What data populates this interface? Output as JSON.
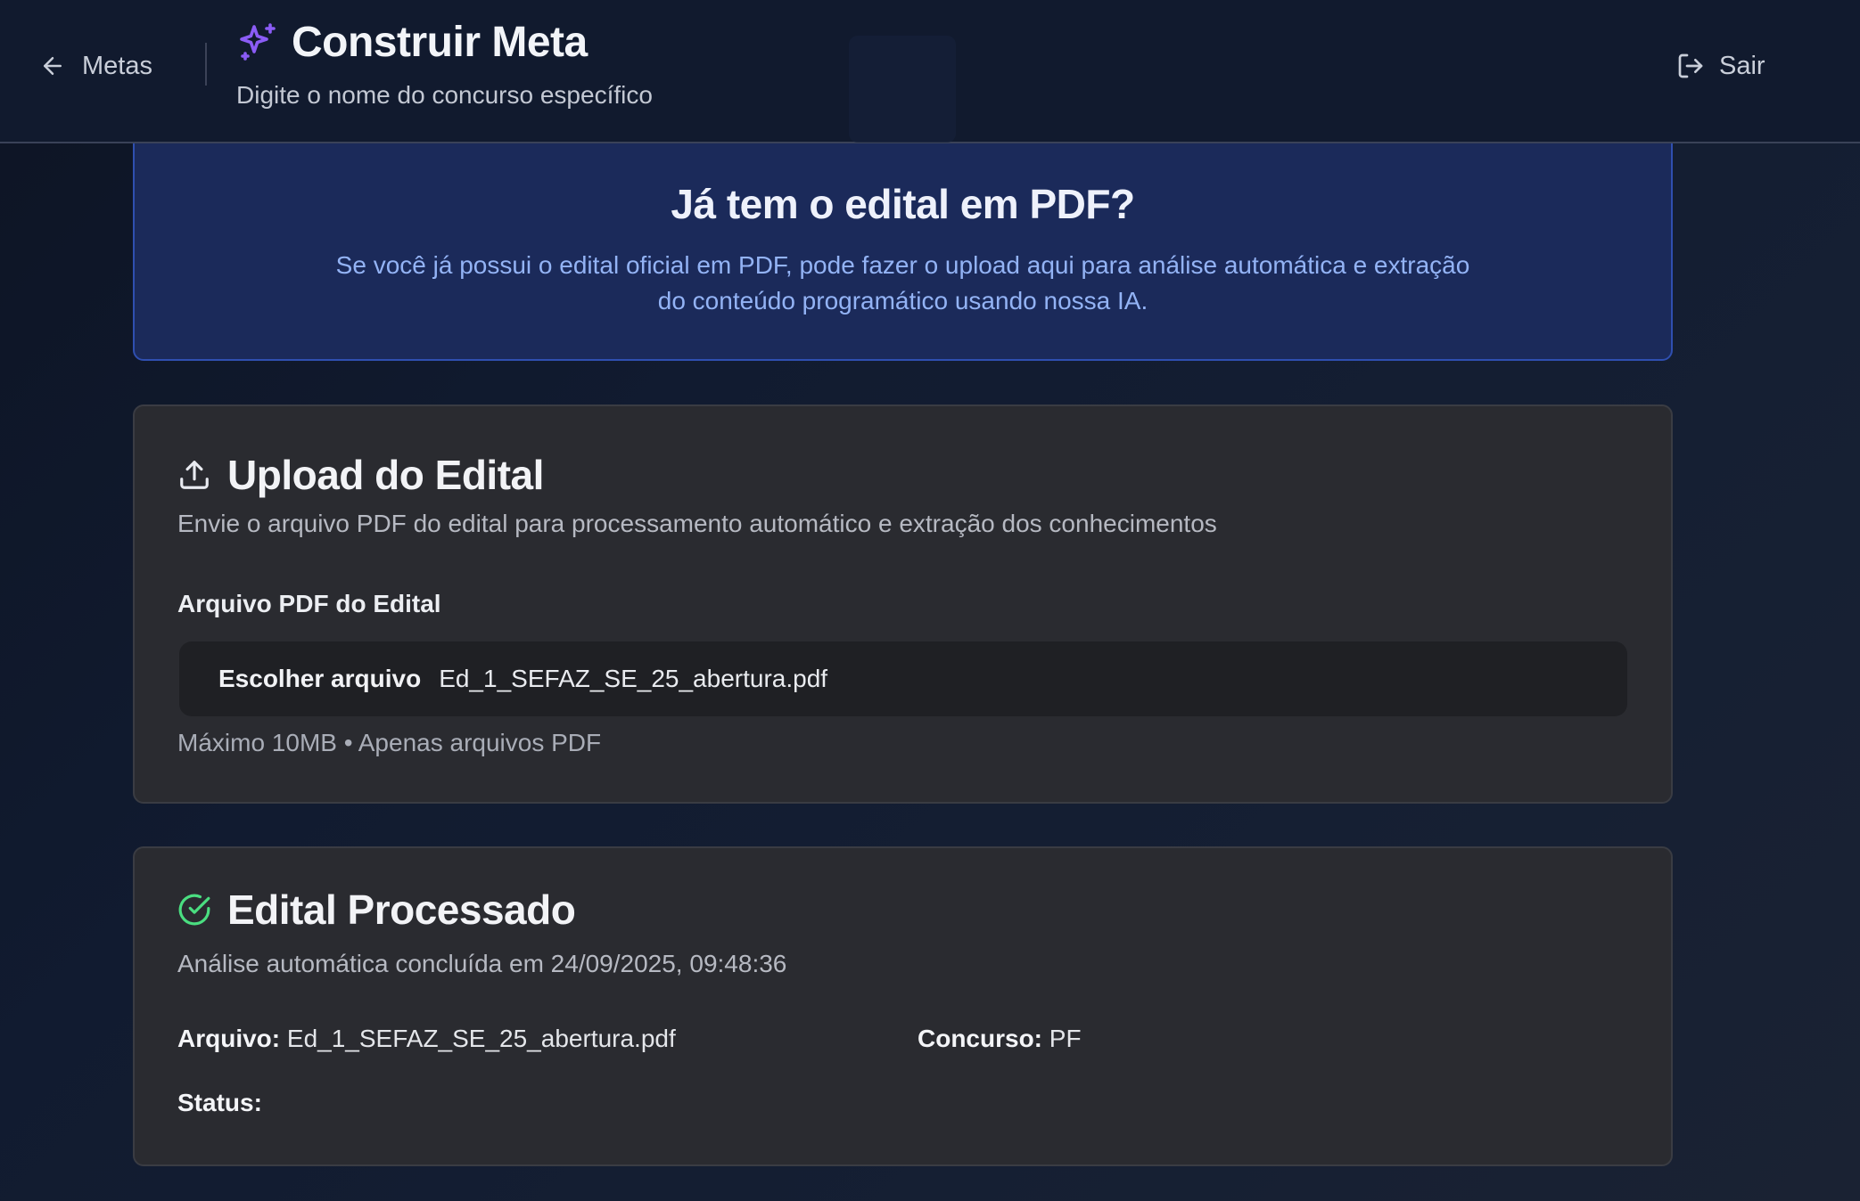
{
  "header": {
    "back_label": "Metas",
    "title": "Construir Meta",
    "subtitle": "Digite o nome do concurso específico",
    "logout_label": "Sair",
    "accent_color": "#8b5cf6"
  },
  "banner": {
    "title": "Já tem o edital em PDF?",
    "description": "Se você já possui o edital oficial em PDF, pode fazer o upload aqui para análise automática e extração do conteúdo programático usando nossa IA."
  },
  "upload_card": {
    "icon": "upload-icon",
    "title": "Upload do Edital",
    "description": "Envie o arquivo PDF do edital para processamento automático e extração dos conhecimentos",
    "field_label": "Arquivo PDF do Edital",
    "choose_button": "Escolher arquivo",
    "file_name": "Ed_1_SEFAZ_SE_25_abertura.pdf",
    "hint": "Máximo 10MB • Apenas arquivos PDF"
  },
  "processed_card": {
    "icon": "check-circle-icon",
    "icon_color": "#4ade80",
    "title": "Edital Processado",
    "description": "Análise automática concluída em 24/09/2025, 09:48:36",
    "file_label": "Arquivo:",
    "file_value": "Ed_1_SEFAZ_SE_25_abertura.pdf",
    "contest_label": "Concurso:",
    "contest_value": "PF",
    "status_label": "Status:"
  }
}
